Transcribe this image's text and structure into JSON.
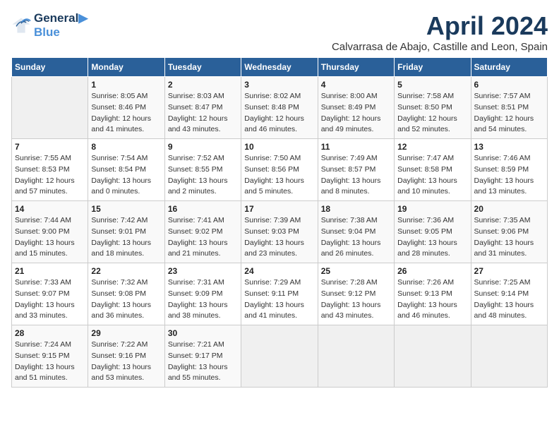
{
  "logo": {
    "line1": "General",
    "line2": "Blue"
  },
  "title": "April 2024",
  "subtitle": "Calvarrasa de Abajo, Castille and Leon, Spain",
  "days_of_week": [
    "Sunday",
    "Monday",
    "Tuesday",
    "Wednesday",
    "Thursday",
    "Friday",
    "Saturday"
  ],
  "weeks": [
    [
      {
        "num": "",
        "info": ""
      },
      {
        "num": "1",
        "info": "Sunrise: 8:05 AM\nSunset: 8:46 PM\nDaylight: 12 hours\nand 41 minutes."
      },
      {
        "num": "2",
        "info": "Sunrise: 8:03 AM\nSunset: 8:47 PM\nDaylight: 12 hours\nand 43 minutes."
      },
      {
        "num": "3",
        "info": "Sunrise: 8:02 AM\nSunset: 8:48 PM\nDaylight: 12 hours\nand 46 minutes."
      },
      {
        "num": "4",
        "info": "Sunrise: 8:00 AM\nSunset: 8:49 PM\nDaylight: 12 hours\nand 49 minutes."
      },
      {
        "num": "5",
        "info": "Sunrise: 7:58 AM\nSunset: 8:50 PM\nDaylight: 12 hours\nand 52 minutes."
      },
      {
        "num": "6",
        "info": "Sunrise: 7:57 AM\nSunset: 8:51 PM\nDaylight: 12 hours\nand 54 minutes."
      }
    ],
    [
      {
        "num": "7",
        "info": "Sunrise: 7:55 AM\nSunset: 8:53 PM\nDaylight: 12 hours\nand 57 minutes."
      },
      {
        "num": "8",
        "info": "Sunrise: 7:54 AM\nSunset: 8:54 PM\nDaylight: 13 hours\nand 0 minutes."
      },
      {
        "num": "9",
        "info": "Sunrise: 7:52 AM\nSunset: 8:55 PM\nDaylight: 13 hours\nand 2 minutes."
      },
      {
        "num": "10",
        "info": "Sunrise: 7:50 AM\nSunset: 8:56 PM\nDaylight: 13 hours\nand 5 minutes."
      },
      {
        "num": "11",
        "info": "Sunrise: 7:49 AM\nSunset: 8:57 PM\nDaylight: 13 hours\nand 8 minutes."
      },
      {
        "num": "12",
        "info": "Sunrise: 7:47 AM\nSunset: 8:58 PM\nDaylight: 13 hours\nand 10 minutes."
      },
      {
        "num": "13",
        "info": "Sunrise: 7:46 AM\nSunset: 8:59 PM\nDaylight: 13 hours\nand 13 minutes."
      }
    ],
    [
      {
        "num": "14",
        "info": "Sunrise: 7:44 AM\nSunset: 9:00 PM\nDaylight: 13 hours\nand 15 minutes."
      },
      {
        "num": "15",
        "info": "Sunrise: 7:42 AM\nSunset: 9:01 PM\nDaylight: 13 hours\nand 18 minutes."
      },
      {
        "num": "16",
        "info": "Sunrise: 7:41 AM\nSunset: 9:02 PM\nDaylight: 13 hours\nand 21 minutes."
      },
      {
        "num": "17",
        "info": "Sunrise: 7:39 AM\nSunset: 9:03 PM\nDaylight: 13 hours\nand 23 minutes."
      },
      {
        "num": "18",
        "info": "Sunrise: 7:38 AM\nSunset: 9:04 PM\nDaylight: 13 hours\nand 26 minutes."
      },
      {
        "num": "19",
        "info": "Sunrise: 7:36 AM\nSunset: 9:05 PM\nDaylight: 13 hours\nand 28 minutes."
      },
      {
        "num": "20",
        "info": "Sunrise: 7:35 AM\nSunset: 9:06 PM\nDaylight: 13 hours\nand 31 minutes."
      }
    ],
    [
      {
        "num": "21",
        "info": "Sunrise: 7:33 AM\nSunset: 9:07 PM\nDaylight: 13 hours\nand 33 minutes."
      },
      {
        "num": "22",
        "info": "Sunrise: 7:32 AM\nSunset: 9:08 PM\nDaylight: 13 hours\nand 36 minutes."
      },
      {
        "num": "23",
        "info": "Sunrise: 7:31 AM\nSunset: 9:09 PM\nDaylight: 13 hours\nand 38 minutes."
      },
      {
        "num": "24",
        "info": "Sunrise: 7:29 AM\nSunset: 9:11 PM\nDaylight: 13 hours\nand 41 minutes."
      },
      {
        "num": "25",
        "info": "Sunrise: 7:28 AM\nSunset: 9:12 PM\nDaylight: 13 hours\nand 43 minutes."
      },
      {
        "num": "26",
        "info": "Sunrise: 7:26 AM\nSunset: 9:13 PM\nDaylight: 13 hours\nand 46 minutes."
      },
      {
        "num": "27",
        "info": "Sunrise: 7:25 AM\nSunset: 9:14 PM\nDaylight: 13 hours\nand 48 minutes."
      }
    ],
    [
      {
        "num": "28",
        "info": "Sunrise: 7:24 AM\nSunset: 9:15 PM\nDaylight: 13 hours\nand 51 minutes."
      },
      {
        "num": "29",
        "info": "Sunrise: 7:22 AM\nSunset: 9:16 PM\nDaylight: 13 hours\nand 53 minutes."
      },
      {
        "num": "30",
        "info": "Sunrise: 7:21 AM\nSunset: 9:17 PM\nDaylight: 13 hours\nand 55 minutes."
      },
      {
        "num": "",
        "info": ""
      },
      {
        "num": "",
        "info": ""
      },
      {
        "num": "",
        "info": ""
      },
      {
        "num": "",
        "info": ""
      }
    ]
  ]
}
